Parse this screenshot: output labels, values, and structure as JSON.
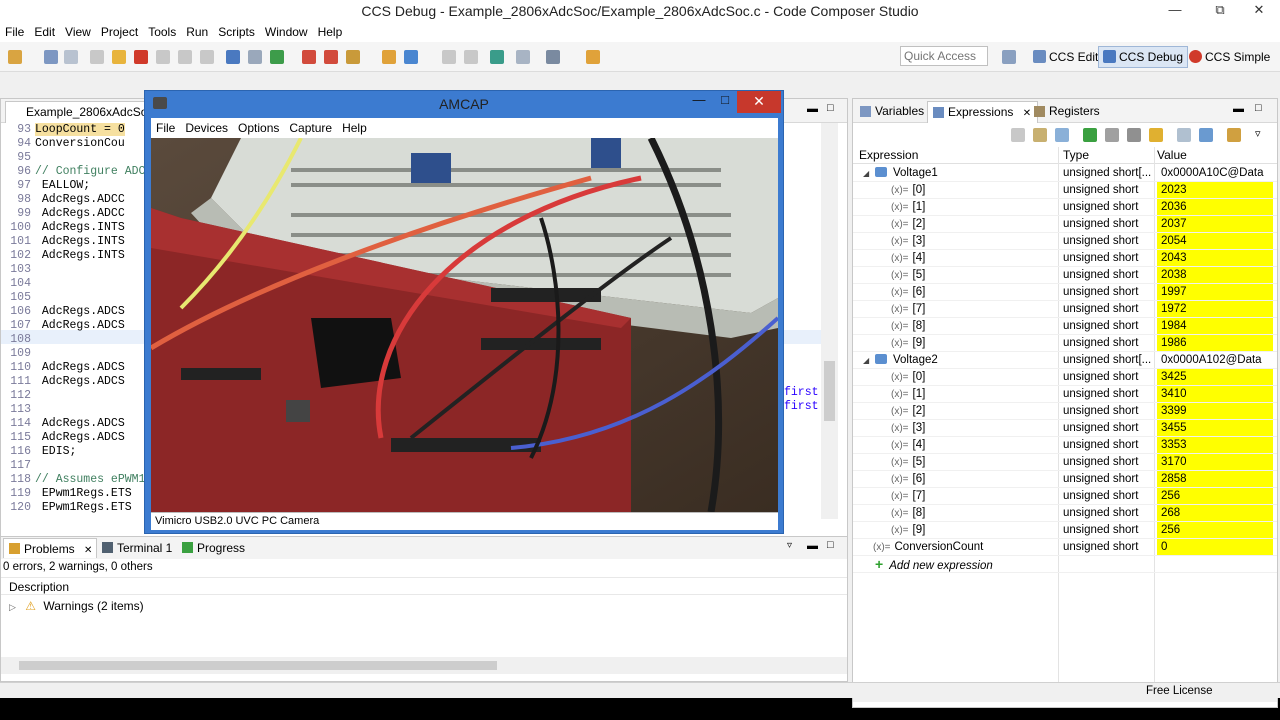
{
  "window": {
    "title": "CCS Debug - Example_2806xAdcSoc/Example_2806xAdcSoc.c - Code Composer Studio",
    "controls": {
      "minimize": "—",
      "restore": "⧉",
      "close": "✕"
    }
  },
  "menubar": [
    "File",
    "Edit",
    "View",
    "Project",
    "Tools",
    "Run",
    "Scripts",
    "Window",
    "Help"
  ],
  "toolbar": {
    "quick_access_placeholder": "Quick Access",
    "perspectives": [
      {
        "label": "CCS Edit",
        "active": false
      },
      {
        "label": "CCS Debug",
        "active": true
      },
      {
        "label": "CCS Simple",
        "active": false
      }
    ]
  },
  "editor": {
    "tab_label": "Example_2806xAdcSoc.c",
    "lines": [
      {
        "num": "93",
        "text": "LoopCount = 0",
        "kind": "code"
      },
      {
        "num": "94",
        "text": "ConversionCou",
        "kind": "code"
      },
      {
        "num": "95",
        "text": "",
        "kind": "code"
      },
      {
        "num": "96",
        "text": "// Configure ADC",
        "kind": "comment"
      },
      {
        "num": "97",
        "text": " EALLOW;",
        "kind": "code"
      },
      {
        "num": "98",
        "text": " AdcRegs.ADCC",
        "kind": "code"
      },
      {
        "num": "99",
        "text": " AdcRegs.ADCC",
        "kind": "code"
      },
      {
        "num": "100",
        "text": " AdcRegs.INTS",
        "kind": "code"
      },
      {
        "num": "101",
        "text": " AdcRegs.INTS",
        "kind": "code"
      },
      {
        "num": "102",
        "text": " AdcRegs.INTS",
        "kind": "code"
      },
      {
        "num": "103",
        "text": "",
        "kind": "code"
      },
      {
        "num": "104",
        "text": "",
        "kind": "code"
      },
      {
        "num": "105",
        "text": "",
        "kind": "code"
      },
      {
        "num": "106",
        "text": " AdcRegs.ADCS",
        "kind": "code"
      },
      {
        "num": "107",
        "text": " AdcRegs.ADCS",
        "kind": "code"
      },
      {
        "num": "108",
        "text": "",
        "kind": "code"
      },
      {
        "num": "109",
        "text": "",
        "kind": "code"
      },
      {
        "num": "110",
        "text": " AdcRegs.ADCS",
        "kind": "code"
      },
      {
        "num": "111",
        "text": " AdcRegs.ADCS",
        "kind": "code"
      },
      {
        "num": "112",
        "text": "",
        "kind": "code"
      },
      {
        "num": "113",
        "text": "",
        "kind": "code"
      },
      {
        "num": "114",
        "text": " AdcRegs.ADCS",
        "kind": "code"
      },
      {
        "num": "115",
        "text": " AdcRegs.ADCS",
        "kind": "code"
      },
      {
        "num": "116",
        "text": " EDIS;",
        "kind": "code"
      },
      {
        "num": "117",
        "text": "",
        "kind": "code"
      },
      {
        "num": "118",
        "text": "// Assumes ePWM1",
        "kind": "comment"
      },
      {
        "num": "119",
        "text": " EPwm1Regs.ETS",
        "kind": "code"
      },
      {
        "num": "120",
        "text": " EPwm1Regs.ETS",
        "kind": "code"
      }
    ],
    "right_fragments": [
      "first",
      "first"
    ]
  },
  "amcap": {
    "title": "AMCAP",
    "menu": [
      "File",
      "Devices",
      "Options",
      "Capture",
      "Help"
    ],
    "status": "Vimicro USB2.0 UVC PC Camera"
  },
  "right_panel": {
    "tabs": [
      {
        "label": "Variables",
        "active": false
      },
      {
        "label": "Expressions",
        "active": true
      },
      {
        "label": "Registers",
        "active": false
      }
    ],
    "columns": [
      "Expression",
      "Type",
      "Value"
    ],
    "rows": [
      {
        "name": "Voltage1",
        "type": "unsigned short[...",
        "value": "0x0000A10C@Data",
        "level": 0,
        "kind": "array",
        "yellow": false
      },
      {
        "name": "[0]",
        "type": "unsigned short",
        "value": "2023",
        "level": 1,
        "kind": "var",
        "yellow": true
      },
      {
        "name": "[1]",
        "type": "unsigned short",
        "value": "2036",
        "level": 1,
        "kind": "var",
        "yellow": true
      },
      {
        "name": "[2]",
        "type": "unsigned short",
        "value": "2037",
        "level": 1,
        "kind": "var",
        "yellow": true
      },
      {
        "name": "[3]",
        "type": "unsigned short",
        "value": "2054",
        "level": 1,
        "kind": "var",
        "yellow": true
      },
      {
        "name": "[4]",
        "type": "unsigned short",
        "value": "2043",
        "level": 1,
        "kind": "var",
        "yellow": true
      },
      {
        "name": "[5]",
        "type": "unsigned short",
        "value": "2038",
        "level": 1,
        "kind": "var",
        "yellow": true
      },
      {
        "name": "[6]",
        "type": "unsigned short",
        "value": "1997",
        "level": 1,
        "kind": "var",
        "yellow": true
      },
      {
        "name": "[7]",
        "type": "unsigned short",
        "value": "1972",
        "level": 1,
        "kind": "var",
        "yellow": true
      },
      {
        "name": "[8]",
        "type": "unsigned short",
        "value": "1984",
        "level": 1,
        "kind": "var",
        "yellow": true
      },
      {
        "name": "[9]",
        "type": "unsigned short",
        "value": "1986",
        "level": 1,
        "kind": "var",
        "yellow": true
      },
      {
        "name": "Voltage2",
        "type": "unsigned short[...",
        "value": "0x0000A102@Data",
        "level": 0,
        "kind": "array",
        "yellow": false
      },
      {
        "name": "[0]",
        "type": "unsigned short",
        "value": "3425",
        "level": 1,
        "kind": "var",
        "yellow": true
      },
      {
        "name": "[1]",
        "type": "unsigned short",
        "value": "3410",
        "level": 1,
        "kind": "var",
        "yellow": true
      },
      {
        "name": "[2]",
        "type": "unsigned short",
        "value": "3399",
        "level": 1,
        "kind": "var",
        "yellow": true
      },
      {
        "name": "[3]",
        "type": "unsigned short",
        "value": "3455",
        "level": 1,
        "kind": "var",
        "yellow": true
      },
      {
        "name": "[4]",
        "type": "unsigned short",
        "value": "3353",
        "level": 1,
        "kind": "var",
        "yellow": true
      },
      {
        "name": "[5]",
        "type": "unsigned short",
        "value": "3170",
        "level": 1,
        "kind": "var",
        "yellow": true
      },
      {
        "name": "[6]",
        "type": "unsigned short",
        "value": "2858",
        "level": 1,
        "kind": "var",
        "yellow": true
      },
      {
        "name": "[7]",
        "type": "unsigned short",
        "value": "256",
        "level": 1,
        "kind": "var",
        "yellow": true
      },
      {
        "name": "[8]",
        "type": "unsigned short",
        "value": "268",
        "level": 1,
        "kind": "var",
        "yellow": true
      },
      {
        "name": "[9]",
        "type": "unsigned short",
        "value": "256",
        "level": 1,
        "kind": "var",
        "yellow": true
      },
      {
        "name": "ConversionCount",
        "type": "unsigned short",
        "value": "0",
        "level": 0,
        "kind": "var",
        "yellow": true
      },
      {
        "name": "Add new expression",
        "type": "",
        "value": "",
        "level": 0,
        "kind": "add",
        "yellow": false
      }
    ]
  },
  "bottom_panel": {
    "tabs": [
      {
        "label": "Problems",
        "active": true
      },
      {
        "label": "Terminal 1",
        "active": false
      },
      {
        "label": "Progress",
        "active": false
      }
    ],
    "summary": "0 errors, 2 warnings, 0 others",
    "column": "Description",
    "warnings_label": "Warnings (2 items)"
  },
  "statusbar": {
    "license": "Free License"
  },
  "colors": {
    "highlight_yellow": "#ffff00",
    "amcap_border": "#3c7bd0",
    "close_red": "#c7382c"
  }
}
